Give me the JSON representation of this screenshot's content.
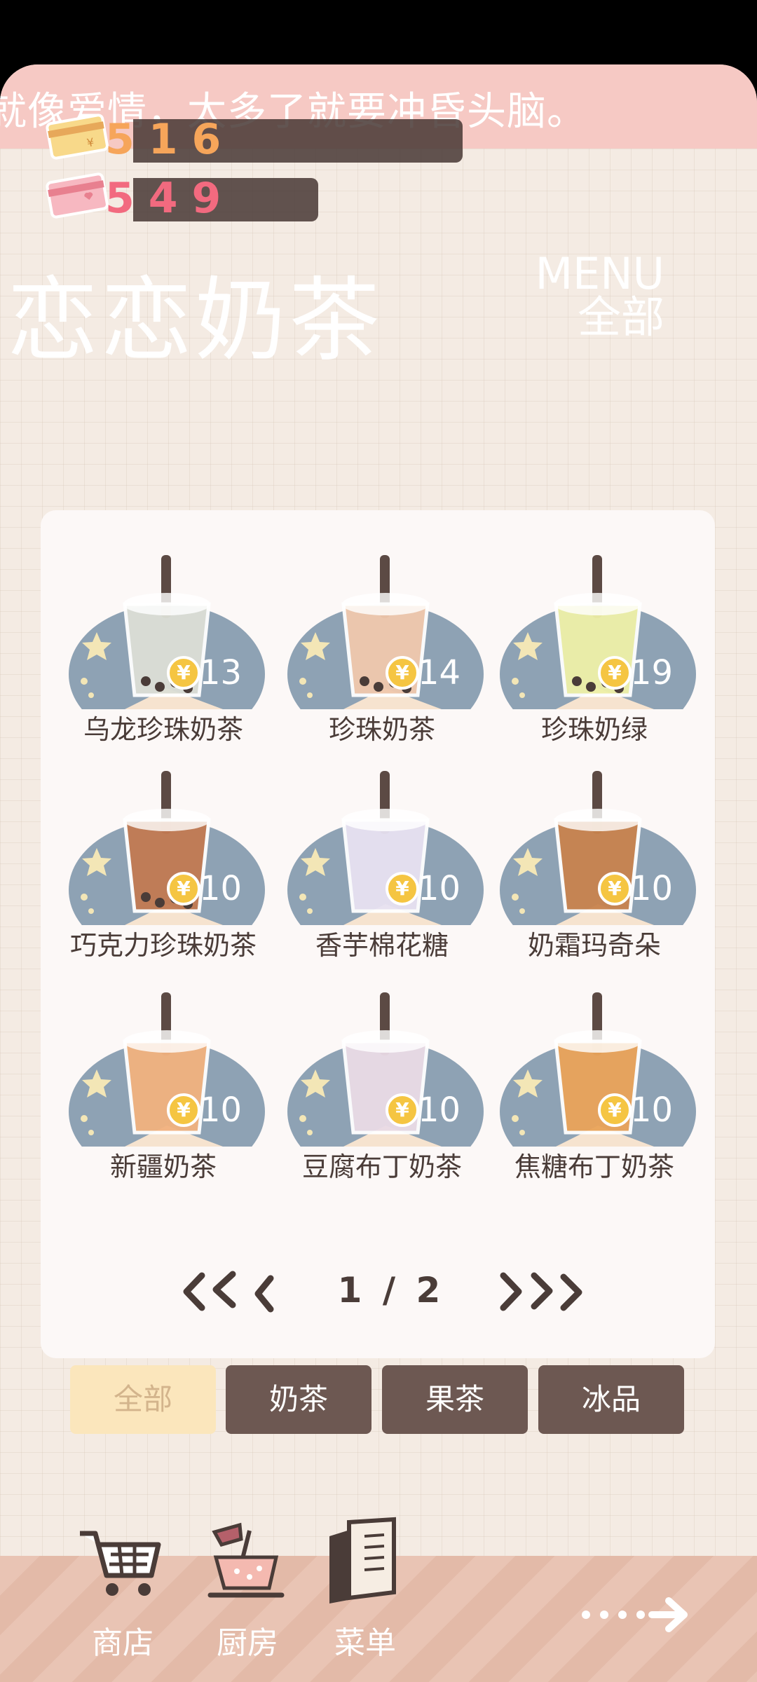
{
  "marquee": {
    "text": "就像爱情，太多了就要冲昏头脑。"
  },
  "currencies": [
    {
      "name": "gold-card",
      "value": "516",
      "color": "#f6a55a"
    },
    {
      "name": "pink-card",
      "value": "549",
      "color": "#f26a7f"
    }
  ],
  "title": "恋恋奶茶",
  "menu": {
    "label_en": "MENU",
    "label_cn": "全部"
  },
  "items": [
    {
      "name": "乌龙珍珠奶茶",
      "price": "13",
      "tea": "#dcdfd6",
      "pearls": true
    },
    {
      "name": "珍珠奶茶",
      "price": "14",
      "tea": "#f0c8ad",
      "pearls": true
    },
    {
      "name": "珍珠奶绿",
      "price": "19",
      "tea": "#eef0a8",
      "pearls": true
    },
    {
      "name": "巧克力珍珠奶茶",
      "price": "10",
      "tea": "#c27a53",
      "pearls": true
    },
    {
      "name": "香芋棉花糖",
      "price": "10",
      "tea": "#e8e2f2",
      "pearls": false
    },
    {
      "name": "奶霜玛奇朵",
      "price": "10",
      "tea": "#c8834e",
      "pearls": false
    },
    {
      "name": "新疆奶茶",
      "price": "10",
      "tea": "#f2b27f",
      "pearls": false
    },
    {
      "name": "豆腐布丁奶茶",
      "price": "10",
      "tea": "#eadbe6",
      "pearls": false
    },
    {
      "name": "焦糖布丁奶茶",
      "price": "10",
      "tea": "#eaa45a",
      "pearls": false
    }
  ],
  "currency_symbol": "¥",
  "pager": {
    "current": "1",
    "total": "2",
    "text": "1 / 2"
  },
  "tabs": [
    "全部",
    "奶茶",
    "果茶",
    "冰品"
  ],
  "active_tab": "全部",
  "bottom_nav": [
    {
      "label": "商店",
      "icon": "cart-icon"
    },
    {
      "label": "厨房",
      "icon": "kitchen-icon"
    },
    {
      "label": "菜单",
      "icon": "menu-book-icon"
    }
  ],
  "colors": {
    "accent_pink": "#f6c9c4",
    "dark_brown": "#6d5852",
    "active_tab": "#fbe6bc",
    "plate": "#8ea2b4"
  }
}
